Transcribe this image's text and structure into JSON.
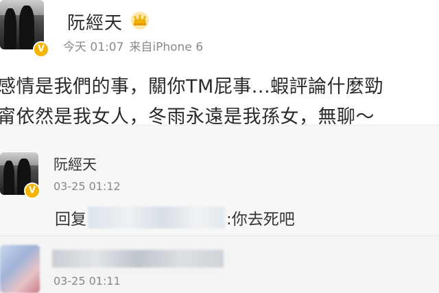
{
  "post": {
    "author_name": "阮經天",
    "time": "今天 01:07",
    "source": "来自iPhone 6",
    "text_line1": "感情是我們的事，關你TM屁事...蝦評論什麼勁",
    "text_line2": "甯依然是我女人，冬雨永遠是我孫女，無聊～"
  },
  "comments": [
    {
      "author_name": "阮經天",
      "time": "03-25 01:12",
      "reply_prefix": "回复",
      "reply_suffix": ":你去死吧"
    },
    {
      "time": "03-25 01:11"
    }
  ],
  "colors": {
    "verified_badge": "#f5b400",
    "crown": "#f0b000"
  },
  "icons": {
    "verified_badge": "verified-v-icon",
    "crown": "crown-icon"
  }
}
